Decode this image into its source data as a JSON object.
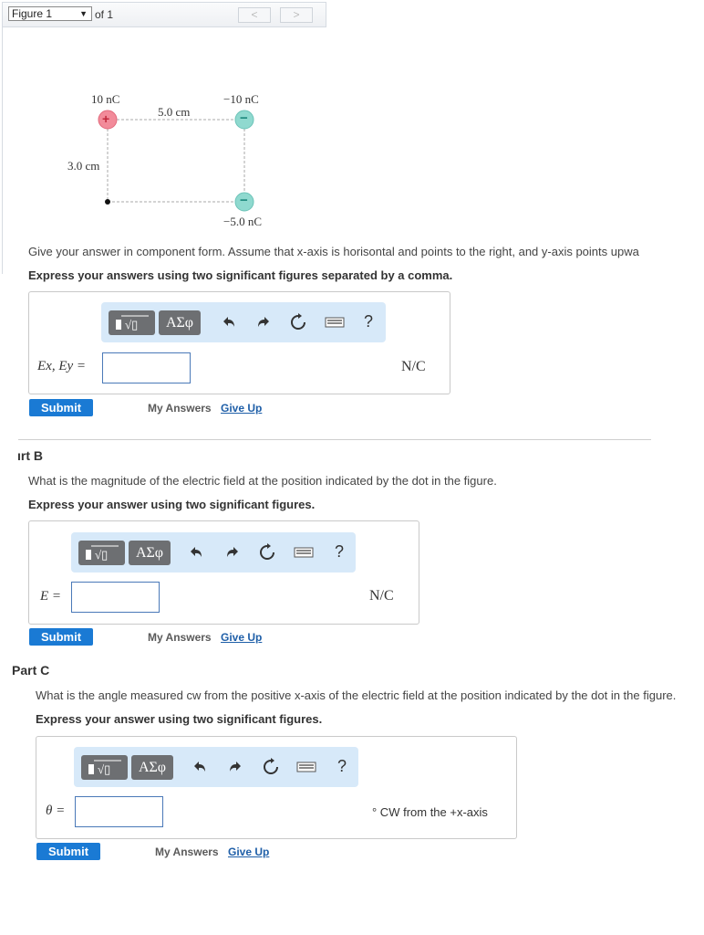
{
  "figure_header": {
    "select_value": "Figure 1",
    "of_label": "of 1",
    "prev": "<",
    "next": ">"
  },
  "diagram": {
    "charge_top_left": "10 nC",
    "charge_top_right": "−10 nC",
    "charge_bottom_right": "−5.0 nC",
    "dist_horizontal": "5.0 cm",
    "dist_vertical": "3.0 cm",
    "plus_sign": "+",
    "minus_sign": "−"
  },
  "part_a": {
    "prompt": "Give your answer in component form. Assume that x-axis is horisontal and points to the right, and y-axis points upwa",
    "express": "Express your answers using two significant figures separated by a comma.",
    "toolbar_greek": "ΑΣφ",
    "help": "?",
    "var_label": "Ex, Ey =",
    "unit": "N/C",
    "submit": "Submit",
    "my_answers": "My Answers",
    "give_up": "Give Up"
  },
  "part_b": {
    "title": "ırt B",
    "prompt": "What is the magnitude of the electric field at the position indicated by the dot in the figure.",
    "express": "Express your answer using two significant figures.",
    "toolbar_greek": "ΑΣφ",
    "help": "?",
    "var_label": "E =",
    "unit": "N/C",
    "submit": "Submit",
    "my_answers": "My Answers",
    "give_up": "Give Up"
  },
  "part_c": {
    "title": "Part C",
    "prompt": "What is the angle measured cw from the positive x-axis of the electric field at the position indicated by the dot in the figure.",
    "express": "Express your answer using two significant figures.",
    "toolbar_greek": "ΑΣφ",
    "help": "?",
    "var_label": "θ =",
    "unit": "° CW from the +x-axis",
    "submit": "Submit",
    "my_answers": "My Answers",
    "give_up": "Give Up"
  },
  "colors": {
    "positive_charge": "#f28b9a",
    "negative_charge": "#8fd9cf",
    "submit_blue": "#1a7ad4",
    "toolbar_bg": "#d7e9f9",
    "input_border": "#4a79b8"
  }
}
